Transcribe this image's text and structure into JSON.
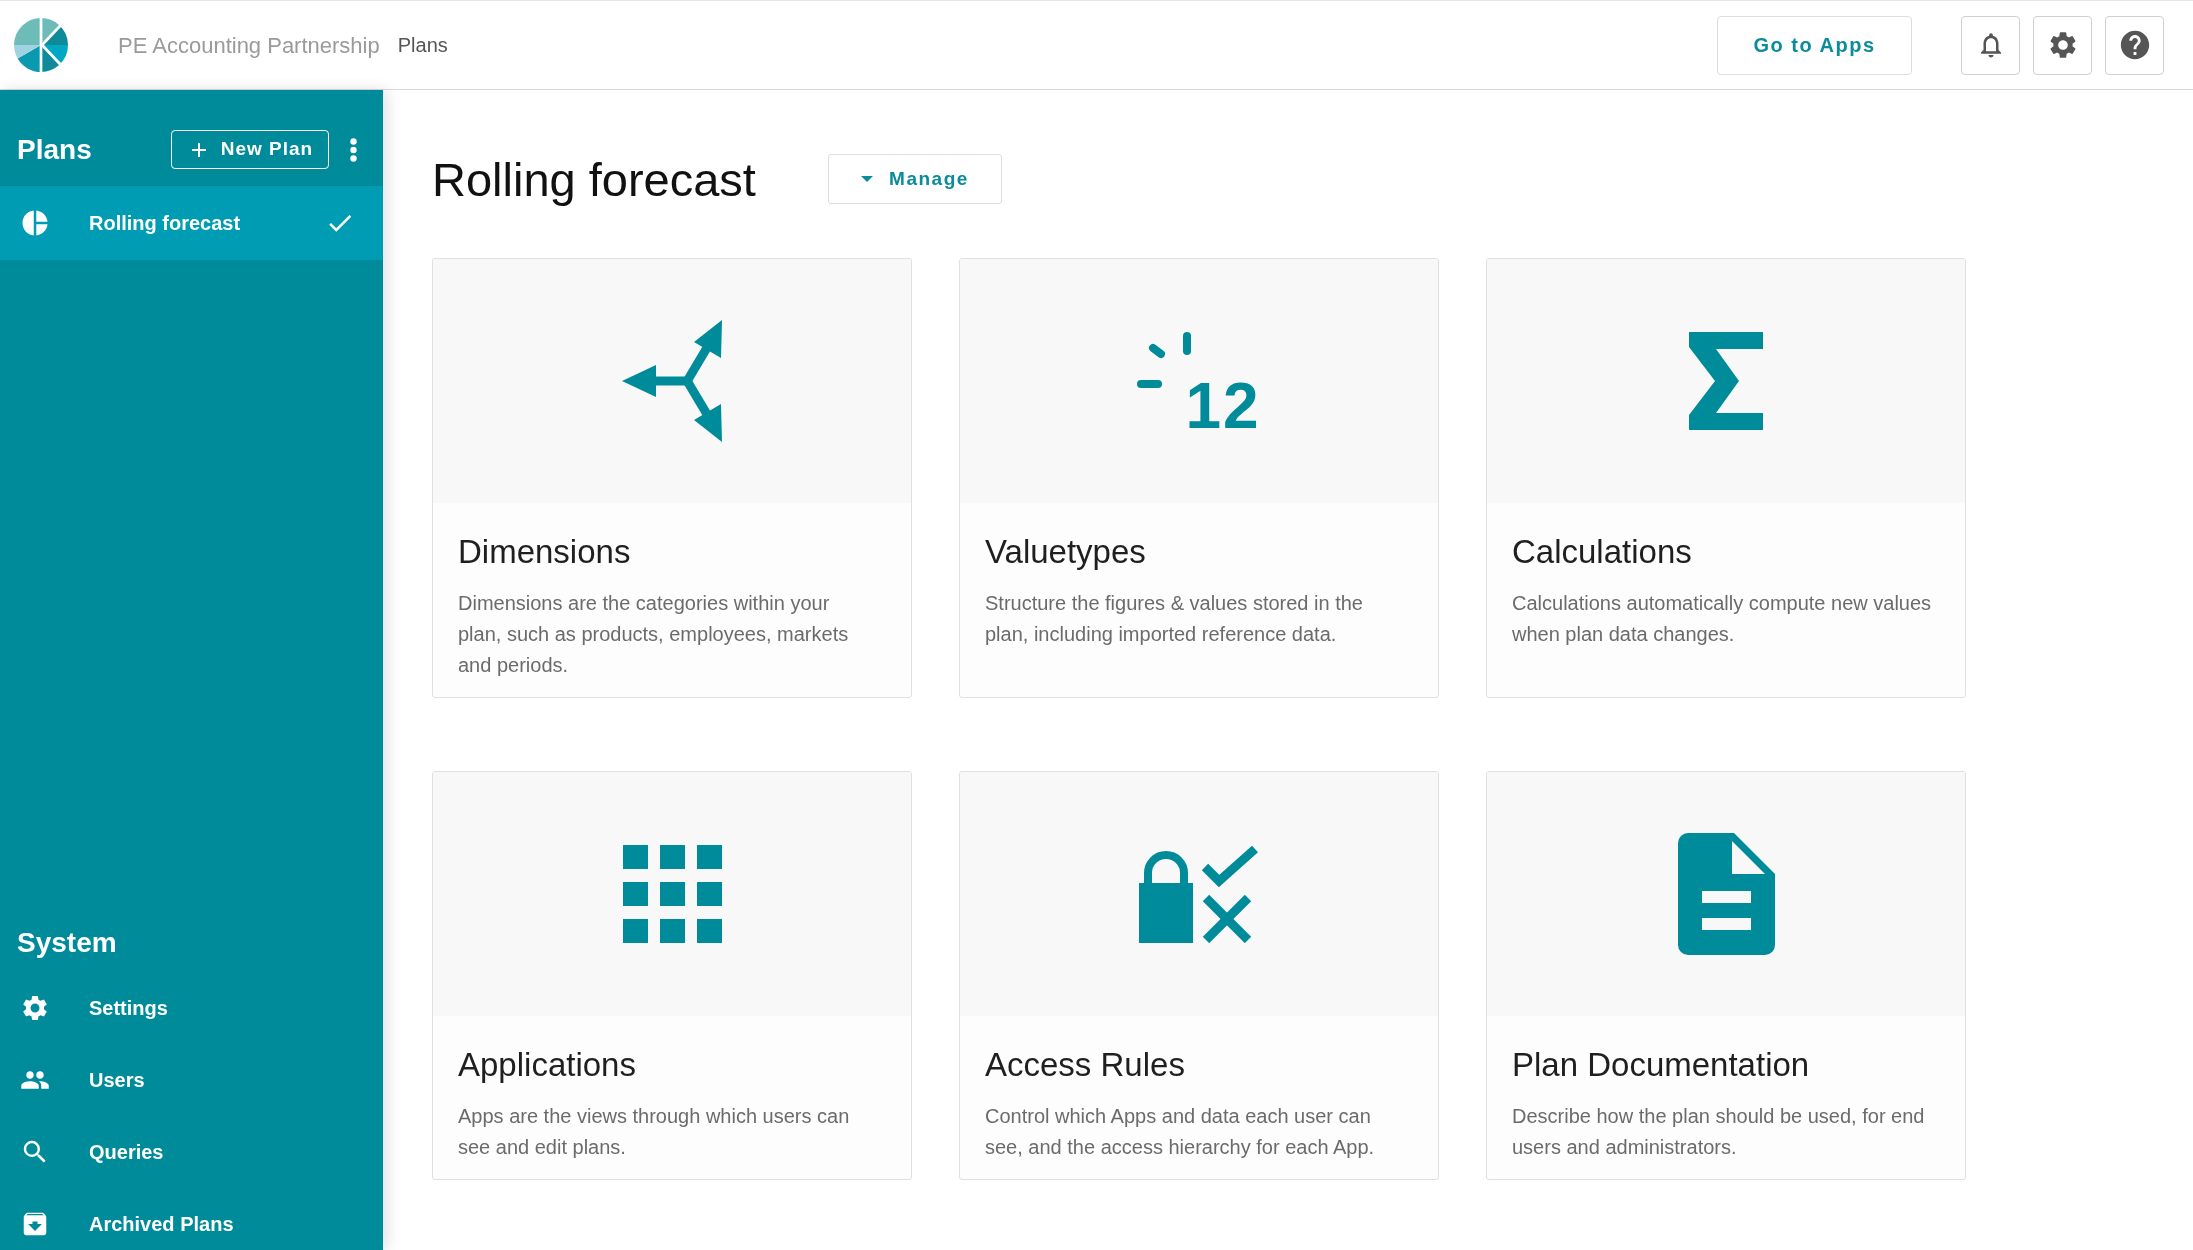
{
  "header": {
    "org_name": "PE Accounting Partnership",
    "breadcrumb": "Plans",
    "go_to_apps_button": "Go to Apps"
  },
  "sidebar": {
    "plans_heading": "Plans",
    "new_plan_button": "New Plan",
    "plans": [
      {
        "label": "Rolling forecast",
        "selected": true
      }
    ],
    "system_heading": "System",
    "system_items": [
      {
        "kind": "settings",
        "label": "Settings"
      },
      {
        "kind": "users",
        "label": "Users"
      },
      {
        "kind": "queries",
        "label": "Queries"
      },
      {
        "kind": "archive",
        "label": "Archived Plans"
      }
    ]
  },
  "main": {
    "title": "Rolling forecast",
    "manage_button": "Manage",
    "cards": [
      {
        "kind": "dimensions",
        "title": "Dimensions",
        "description": "Dimensions are the categories within your plan, such as products, employees, markets and periods."
      },
      {
        "kind": "valuetypes",
        "icon_text": "12",
        "title": "Valuetypes",
        "description": "Structure the figures & values stored in the plan, including imported reference data."
      },
      {
        "kind": "calculations",
        "title": "Calculations",
        "description": "Calculations automatically compute new values when plan data changes."
      },
      {
        "kind": "applications",
        "title": "Applications",
        "description": "Apps are the views through which users can see and edit plans."
      },
      {
        "kind": "access",
        "title": "Access Rules",
        "description": "Control which Apps and data each user can see, and the access hierarchy for each App."
      },
      {
        "kind": "documentation",
        "title": "Plan Documentation",
        "description": "Describe how the plan should be used, for end users and administrators."
      }
    ]
  }
}
